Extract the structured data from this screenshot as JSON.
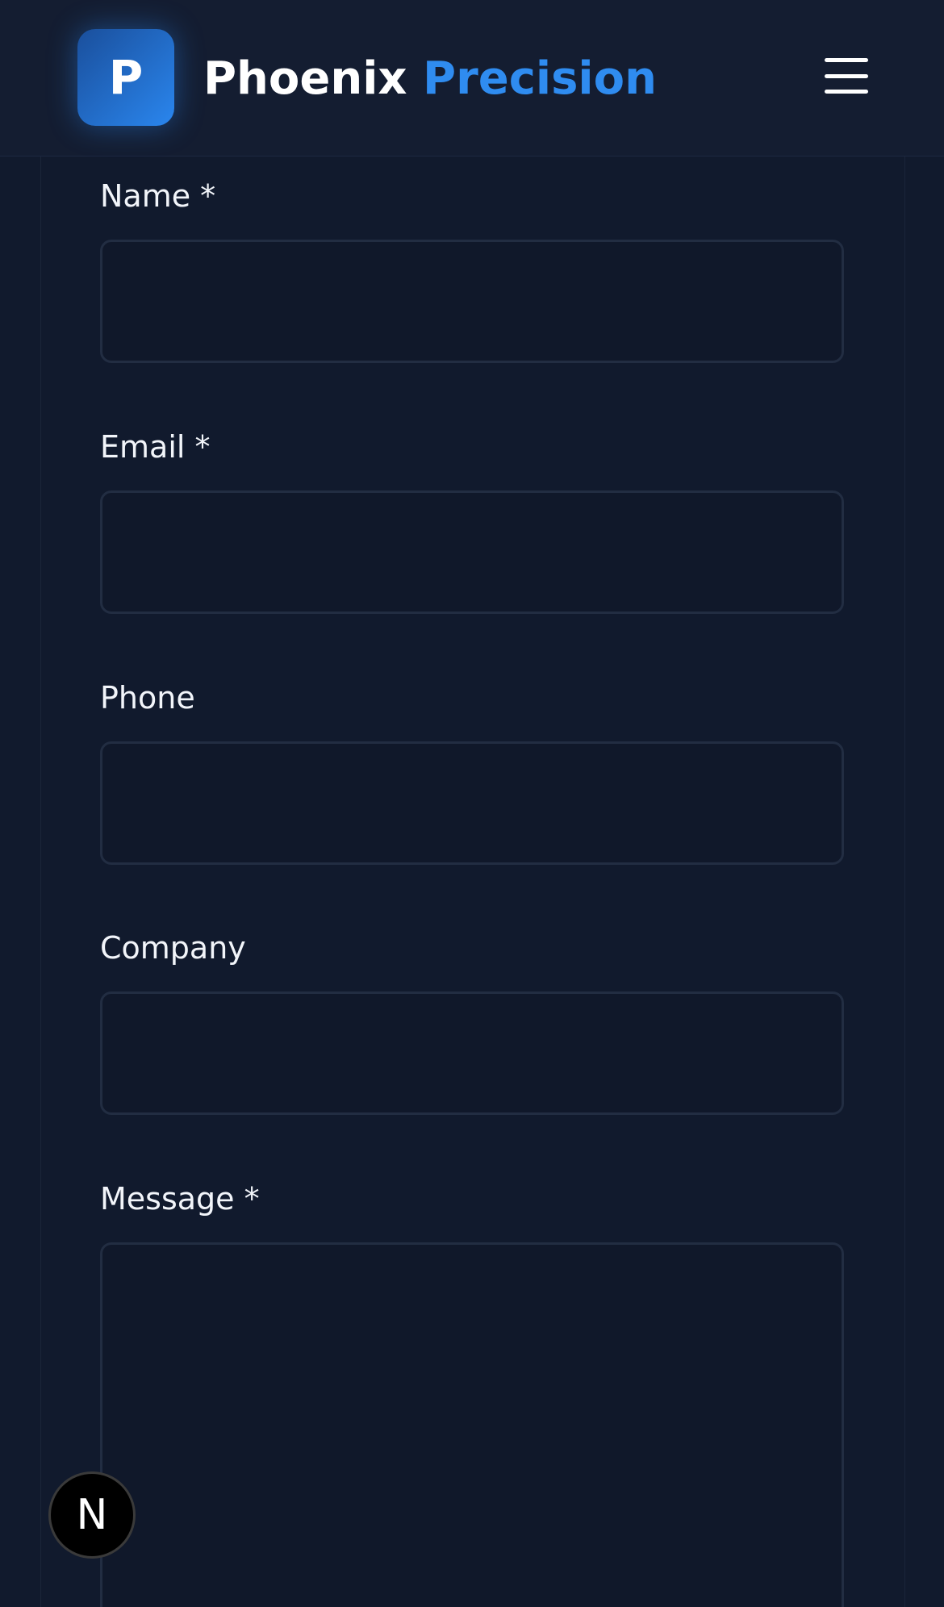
{
  "header": {
    "logo_letter": "P",
    "brand_primary": "Phoenix",
    "brand_accent": "Precision",
    "accent_color": "#2f8cf0",
    "menu_icon": "hamburger-menu-icon"
  },
  "form": {
    "fields": [
      {
        "label": "Name *",
        "value": "",
        "placeholder": ""
      },
      {
        "label": "Email *",
        "value": "",
        "placeholder": ""
      },
      {
        "label": "Phone",
        "value": "",
        "placeholder": ""
      },
      {
        "label": "Company",
        "value": "",
        "placeholder": ""
      },
      {
        "label": "Message *",
        "value": "",
        "placeholder": ""
      }
    ]
  },
  "badge": {
    "letter": "N",
    "icon": "nextjs-dev-indicator-icon"
  }
}
